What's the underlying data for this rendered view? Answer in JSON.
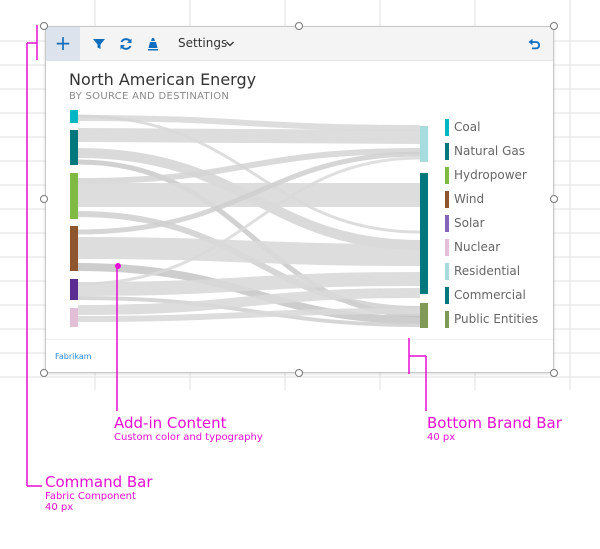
{
  "command_bar": {
    "add_icon": "plus-icon",
    "filter_icon": "filter-icon",
    "refresh_icon": "refresh-icon",
    "brush_icon": "paint-bucket-icon",
    "settings_label": "Settings",
    "settings_icon": "chevron-down-icon",
    "undo_icon": "undo-icon",
    "accent": "#106ebe"
  },
  "content": {
    "title": "North American Energy",
    "subtitle": "BY SOURCE AND DESTINATION"
  },
  "sankey": {
    "sources": [
      {
        "key": "coal",
        "color": "#00b7c3"
      },
      {
        "key": "gas",
        "color": "#03787c"
      },
      {
        "key": "hydro",
        "color": "#7fba42"
      },
      {
        "key": "wind",
        "color": "#8e562e"
      },
      {
        "key": "solar",
        "color": "#5c2d91"
      },
      {
        "key": "nuclear",
        "color": "#e3bfd7"
      }
    ],
    "destinations": [
      {
        "key": "residential",
        "color": "#a6dcdd"
      },
      {
        "key": "commercial",
        "color": "#03787c"
      },
      {
        "key": "public",
        "color": "#7e9a56"
      }
    ],
    "legend": [
      {
        "label": "Coal",
        "color": "#00b7c3"
      },
      {
        "label": "Natural Gas",
        "color": "#03787c"
      },
      {
        "label": "Hydropower",
        "color": "#7fba42"
      },
      {
        "label": "Wind",
        "color": "#8e562e"
      },
      {
        "label": "Solar",
        "color": "#8764b8"
      },
      {
        "label": "Nuclear",
        "color": "#e3bfd7"
      },
      {
        "label": "Residential",
        "color": "#a6dcdd"
      },
      {
        "label": "Commercial",
        "color": "#03787c"
      },
      {
        "label": "Public Entities",
        "color": "#7e9a56"
      }
    ]
  },
  "brand_bar": {
    "brand": "Fabrikam"
  },
  "annotations": {
    "addin_title": "Add-in Content",
    "addin_sub": "Custom color and typography",
    "bottom_title": "Bottom Brand Bar",
    "bottom_sub": "40 px",
    "cmd_title": "Command Bar",
    "cmd_sub1": "Fabric Component",
    "cmd_sub2": "40 px",
    "color": "#e60fd3"
  }
}
